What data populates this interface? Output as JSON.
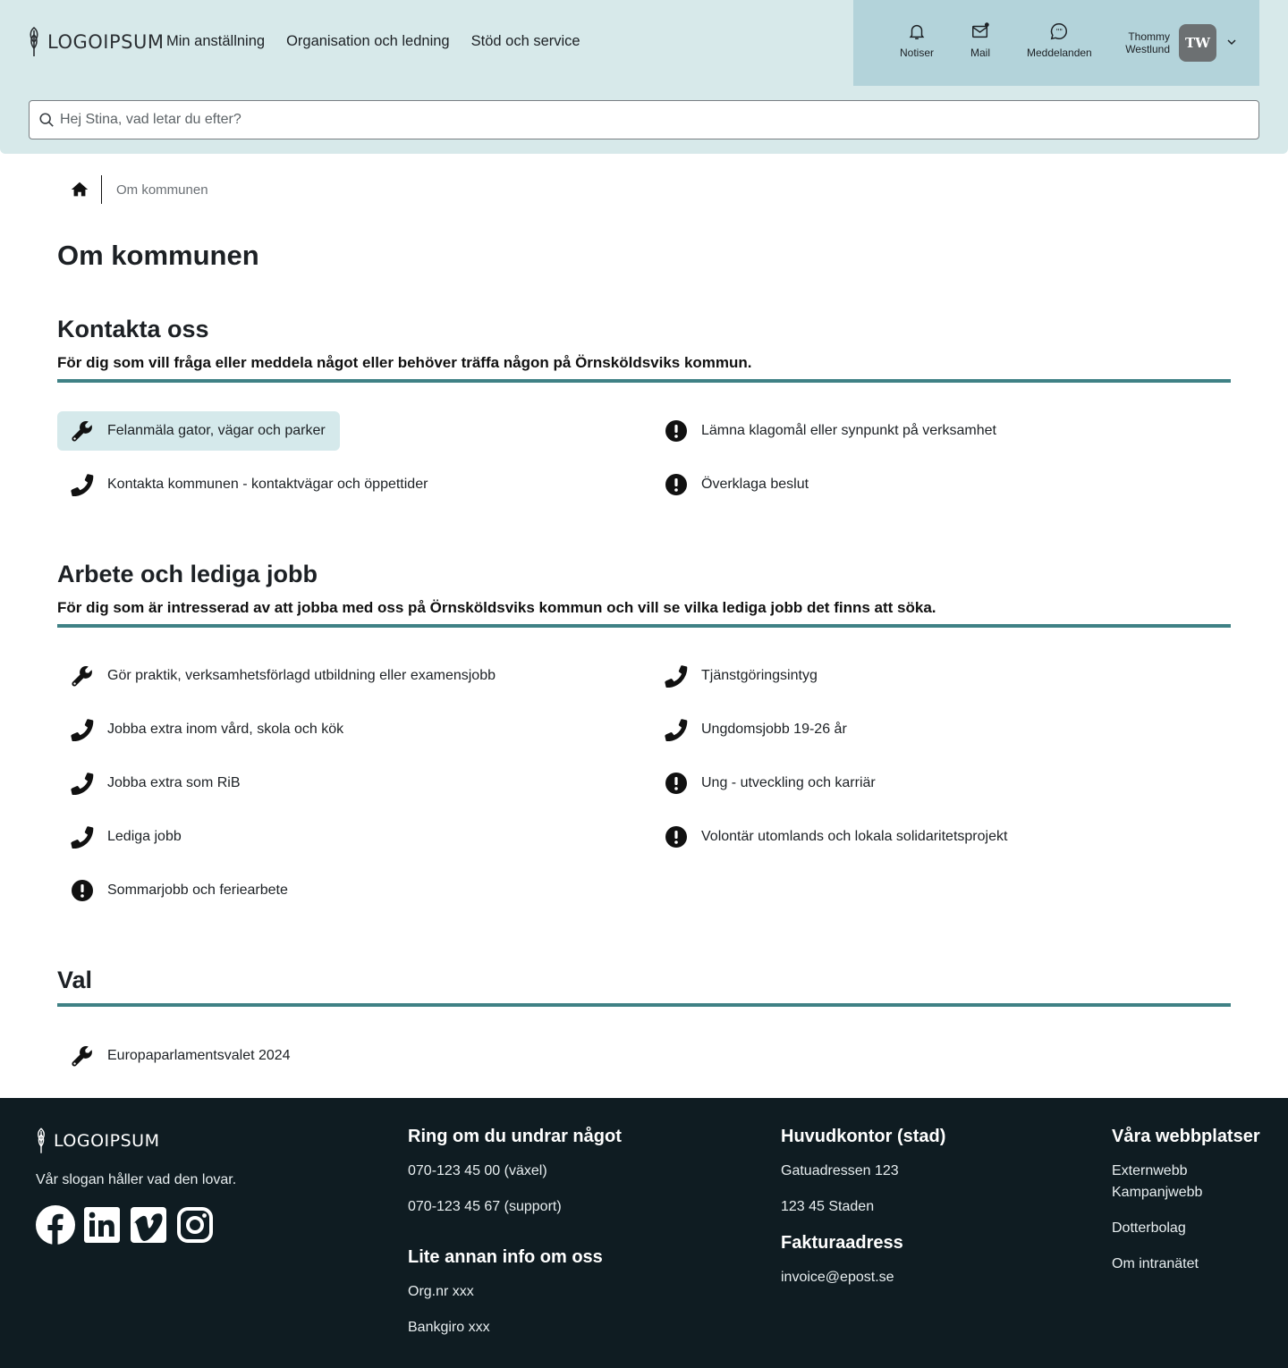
{
  "header": {
    "logo_text": "LOGOIPSUM",
    "nav": [
      "Min anställning",
      "Organisation och ledning",
      "Stöd och service"
    ],
    "utility": {
      "notices": "Notiser",
      "mail": "Mail",
      "messages": "Meddelanden"
    },
    "user": {
      "first_name": "Thommy",
      "last_name": "Westlund",
      "initials": "TW"
    },
    "search_placeholder": "Hej Stina, vad letar du efter?"
  },
  "breadcrumb": {
    "current": "Om kommunen"
  },
  "page": {
    "title": "Om kommunen"
  },
  "sections": {
    "kontakta": {
      "title": "Kontakta oss",
      "subtitle": "För dig som vill fråga eller meddela något eller behöver träffa någon på Örnsköldsviks kommun.",
      "left": [
        {
          "label": "Felanmäla gator, vägar och parker",
          "icon": "wrench-icon"
        },
        {
          "label": "Kontakta kommunen - kontaktvägar och öppettider",
          "icon": "phone-icon"
        }
      ],
      "right": [
        {
          "label": "Lämna klagomål eller synpunkt på verksamhet",
          "icon": "exclamation-icon"
        },
        {
          "label": "Överklaga beslut",
          "icon": "exclamation-icon"
        }
      ]
    },
    "arbete": {
      "title": "Arbete och lediga jobb",
      "subtitle": "För dig som är intresserad av att jobba med oss på Örnsköldsviks kommun och vill se vilka lediga jobb det finns att söka.",
      "left": [
        {
          "label": "Gör praktik, verksamhetsförlagd utbildning eller examensjobb",
          "icon": "wrench-icon"
        },
        {
          "label": "Jobba extra inom vård, skola och kök",
          "icon": "phone-icon"
        },
        {
          "label": "Jobba extra som RiB",
          "icon": "phone-icon"
        },
        {
          "label": "Lediga jobb",
          "icon": "phone-icon"
        },
        {
          "label": "Sommarjobb och feriearbete",
          "icon": "exclamation-icon"
        }
      ],
      "right": [
        {
          "label": "Tjänstgöringsintyg",
          "icon": "phone-icon"
        },
        {
          "label": "Ungdomsjobb 19-26 år",
          "icon": "phone-icon"
        },
        {
          "label": "Ung - utveckling och karriär",
          "icon": "exclamation-icon"
        },
        {
          "label": "Volontär utomlands och lokala solidaritetsprojekt",
          "icon": "exclamation-icon"
        }
      ]
    },
    "val": {
      "title": "Val",
      "left": [
        {
          "label": "Europaparlamentsvalet 2024",
          "icon": "wrench-icon"
        }
      ]
    }
  },
  "footer": {
    "logo_text": "LOGOIPSUM",
    "slogan": "Vår slogan håller vad den lovar.",
    "socials": [
      "facebook-icon",
      "linkedin-icon",
      "vimeo-icon",
      "instagram-icon"
    ],
    "ring": {
      "title": "Ring om du undrar något",
      "lines": [
        "070-123 45 00 (växel)",
        "070-123 45 67 (support)"
      ]
    },
    "info": {
      "title": "Lite annan info om oss",
      "lines": [
        "Org.nr xxx",
        "Bankgiro xxx"
      ]
    },
    "huvudkontor": {
      "title": "Huvudkontor (stad)",
      "lines": [
        "Gatuadressen 123",
        "123 45 Staden"
      ]
    },
    "faktura": {
      "title": "Fakturaadress",
      "lines": [
        "invoice@epost.se"
      ]
    },
    "webb": {
      "title": "Våra webbplatser",
      "lines": [
        "Externwebb",
        "Kampanjwebb",
        "Dotterbolag",
        "Om intranätet"
      ]
    }
  },
  "colors": {
    "header_bg": "#d7e9ea",
    "userpanel_bg": "#b3d3da",
    "accent_rule": "#3f8185",
    "footer_bg": "#0f1c22",
    "active_link_bg": "#d5e9eb"
  }
}
